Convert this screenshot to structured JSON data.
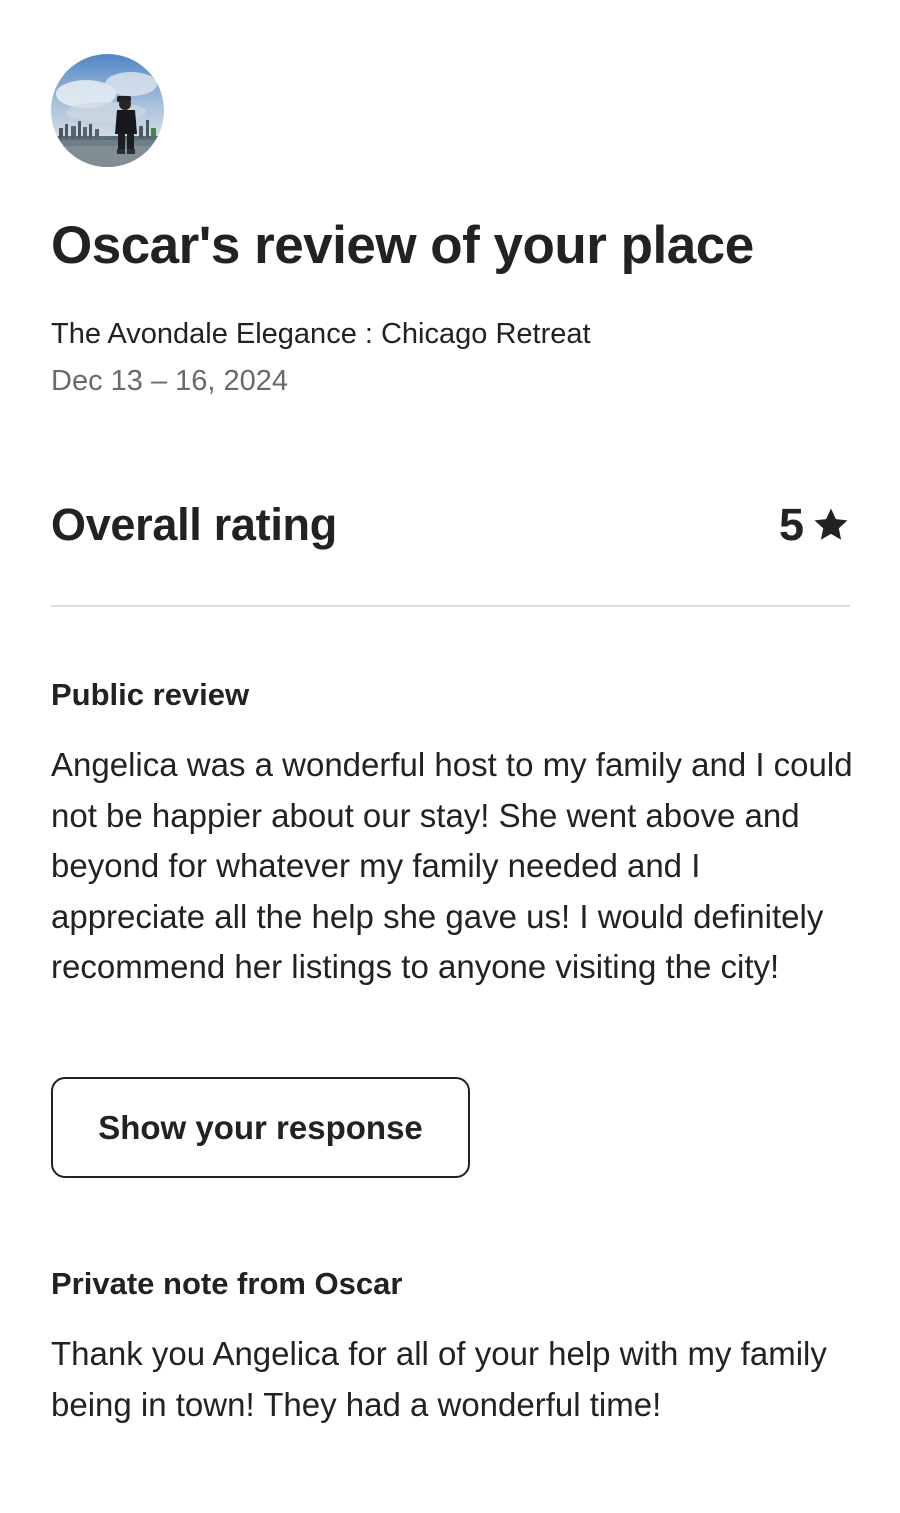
{
  "review": {
    "title": "Oscar's review of your place",
    "listing_name": "The Avondale Elegance : Chicago Retreat",
    "dates": "Dec 13 – 16, 2024"
  },
  "rating": {
    "label": "Overall rating",
    "value": "5",
    "icon": "star-icon"
  },
  "public_review": {
    "heading": "Public review",
    "text": "Angelica was a wonderful host to my family and I could not be happier about our stay! She went above and beyond for whatever my family needed and I appreciate all the help she gave us! I would definitely recommend her listings to anyone visiting the city!",
    "button_label": "Show your response"
  },
  "private_note": {
    "heading": "Private note from Oscar",
    "text": "Thank you Angelica for all of your help with my family being in town! They had a wonderful time!"
  },
  "colors": {
    "text": "#222222",
    "secondary_text": "#6a6a6a",
    "divider": "#dddddd",
    "button_border": "#222222"
  }
}
